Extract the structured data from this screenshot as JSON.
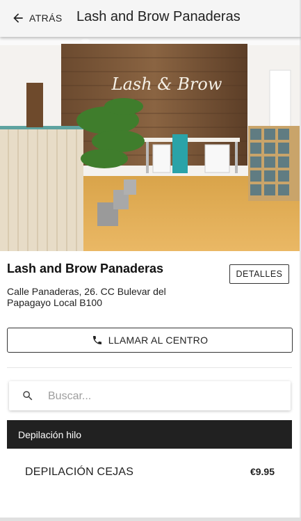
{
  "header": {
    "back_label": "ATRÁS",
    "title": "Lash and Brow Panaderas",
    "back_icon": "arrow-left-icon"
  },
  "hero": {
    "sign_text": "Lash & Brow",
    "description_icon": "salon-photo"
  },
  "center": {
    "name": "Lash and Brow Panaderas",
    "details_label": "DETALLES",
    "address_line1": "Calle Panaderas, 26. CC Bulevar del",
    "address_line2": "Papagayo Local B100",
    "call_label": "LLAMAR AL CENTRO",
    "call_icon": "phone-icon"
  },
  "search": {
    "placeholder": "Buscar...",
    "value": "",
    "icon": "search-icon"
  },
  "categories": [
    {
      "label": "Depilación hilo",
      "services": [
        {
          "name": "DEPILACIÓN CEJAS",
          "price": "€9.95"
        }
      ]
    }
  ],
  "colors": {
    "category_bg": "#212121",
    "topbar_bg": "#f5f5f5",
    "text": "#212121",
    "placeholder": "#9e9e9e"
  }
}
